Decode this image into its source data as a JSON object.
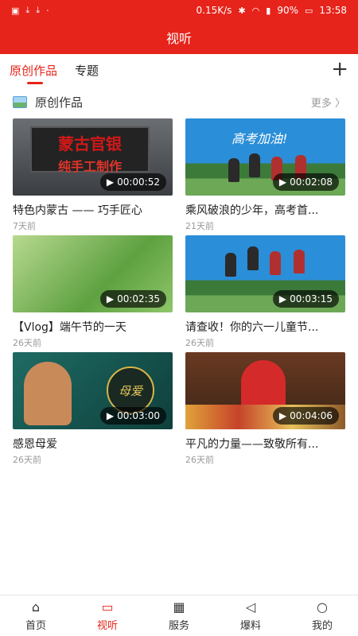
{
  "status": {
    "icons_left": [
      "image-icon",
      "download-icon",
      "download-icon",
      "dot-icon"
    ],
    "speed": "0.15K/s",
    "battery": "90%",
    "time": "13:58"
  },
  "header": {
    "title": "视听"
  },
  "tabs": [
    {
      "label": "原创作品",
      "active": true
    },
    {
      "label": "专题",
      "active": false
    }
  ],
  "add_label": "+",
  "section": {
    "title": "原创作品",
    "more": "更多 〉"
  },
  "videos": [
    {
      "title": "特色内蒙古 —— 巧手匠心",
      "duration": "00:00:52",
      "time": "7天前"
    },
    {
      "title": "乘风破浪的少年，高考首...",
      "duration": "00:02:08",
      "time": "21天前"
    },
    {
      "title": "【Vlog】端午节的一天",
      "duration": "00:02:35",
      "time": "26天前"
    },
    {
      "title": "请查收！你的六一儿童节...",
      "duration": "00:03:15",
      "time": "26天前"
    },
    {
      "title": "感恩母爱",
      "duration": "00:03:00",
      "time": "26天前"
    },
    {
      "title": "平凡的力量——致敬所有...",
      "duration": "00:04:06",
      "time": "26天前"
    }
  ],
  "thumb_text": {
    "sign_line1": "蒙古官银",
    "sign_line2": "纯手工制作",
    "cheer": "高考加油!",
    "mother": "母爱"
  },
  "nav": [
    {
      "label": "首页",
      "icon": "home-icon",
      "active": false
    },
    {
      "label": "视听",
      "icon": "tv-icon",
      "active": true
    },
    {
      "label": "服务",
      "icon": "grid-icon",
      "active": false
    },
    {
      "label": "爆料",
      "icon": "megaphone-icon",
      "active": false
    },
    {
      "label": "我的",
      "icon": "user-icon",
      "active": false
    }
  ],
  "colors": {
    "brand": "#e6241b"
  }
}
